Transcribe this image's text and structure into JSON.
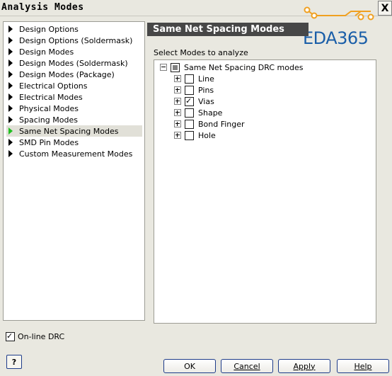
{
  "window": {
    "title": "Analysis Modes",
    "close_glyph": "X"
  },
  "logo": {
    "text": "EDA365"
  },
  "nav": {
    "items": [
      {
        "label": "Design Options",
        "selected": false
      },
      {
        "label": "Design Options (Soldermask)",
        "selected": false
      },
      {
        "label": "Design Modes",
        "selected": false
      },
      {
        "label": "Design Modes (Soldermask)",
        "selected": false
      },
      {
        "label": "Design Modes (Package)",
        "selected": false
      },
      {
        "label": "Electrical Options",
        "selected": false
      },
      {
        "label": "Electrical Modes",
        "selected": false
      },
      {
        "label": "Physical Modes",
        "selected": false
      },
      {
        "label": "Spacing Modes",
        "selected": false
      },
      {
        "label": "Same Net Spacing Modes",
        "selected": true
      },
      {
        "label": "SMD Pin Modes",
        "selected": false
      },
      {
        "label": "Custom Measurement Modes",
        "selected": false
      }
    ]
  },
  "main": {
    "header": "Same Net Spacing Modes",
    "select_label": "Select Modes to analyze",
    "tree": {
      "root_label": "Same Net Spacing DRC modes",
      "children": [
        {
          "label": "Line",
          "checked": false
        },
        {
          "label": "Pins",
          "checked": false
        },
        {
          "label": "Vias",
          "checked": true
        },
        {
          "label": "Shape",
          "checked": false
        },
        {
          "label": "Bond Finger",
          "checked": false
        },
        {
          "label": "Hole",
          "checked": false
        }
      ]
    }
  },
  "footer": {
    "online_drc_label": "On-line DRC",
    "online_drc_checked": true,
    "help_icon_text": "?",
    "ok_label": "OK",
    "cancel_label": "Cancel",
    "apply_label": "Apply",
    "help_label": "Help"
  },
  "colors": {
    "header_bg": "#474747",
    "selected_arrow": "#20c020",
    "logo_blue": "#1a5ea8",
    "logo_orange": "#f0a020"
  }
}
